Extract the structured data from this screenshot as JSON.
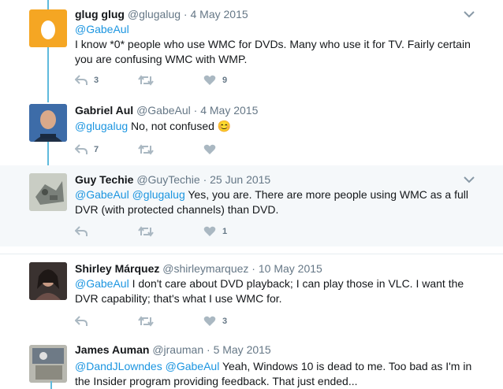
{
  "tweets": [
    {
      "name": "glug glug",
      "handle": "@glugalug",
      "sep": "·",
      "time": "4 May 2015",
      "mention": "@GabeAul",
      "text": "I know *0* people who use WMC for DVDs.  Many who use it for TV.  Fairly certain you are confusing WMC with WMP.",
      "replies": "3",
      "retweets": "",
      "likes": "9"
    },
    {
      "name": "Gabriel Aul",
      "handle": "@GabeAul",
      "sep": "·",
      "time": "4 May 2015",
      "mention": "@glugalug",
      "text": " No, not confused ",
      "emoji": "😊",
      "replies": "7",
      "retweets": "",
      "likes": ""
    },
    {
      "name": "Guy Techie",
      "handle": "@GuyTechie",
      "sep": "·",
      "time": "25 Jun 2015",
      "mention": "@GabeAul @glugalug",
      "text": " Yes, you are.  There are more people using WMC as a full DVR (with protected channels) than DVD.",
      "replies": "",
      "retweets": "",
      "likes": "1"
    },
    {
      "name": "Shirley Márquez",
      "handle": "@shirleymarquez",
      "sep": "·",
      "time": "10 May 2015",
      "mention": "@GabeAul",
      "text": " I don't care about DVD playback; I can play those in VLC. I want the DVR capability; that's what I use WMC for.",
      "replies": "",
      "retweets": "",
      "likes": "3"
    },
    {
      "name": "James Auman",
      "handle": "@jrauman",
      "sep": "·",
      "time": "5 May 2015",
      "mention": "@DandJLowndes @GabeAul",
      "text": " Yeah, Windows 10 is dead to me.  Too bad as I'm in the Insider program providing feedback.  That just ended..."
    }
  ],
  "colors": {
    "accent": "#1b95e0",
    "thread": "#5fbadc",
    "muted": "#657786",
    "icon": "#aab8c2",
    "egg_bg": "#f5a623"
  },
  "icons": [
    "reply-icon",
    "retweet-icon",
    "like-icon",
    "chevron-down-icon",
    "egg-avatar-icon"
  ]
}
